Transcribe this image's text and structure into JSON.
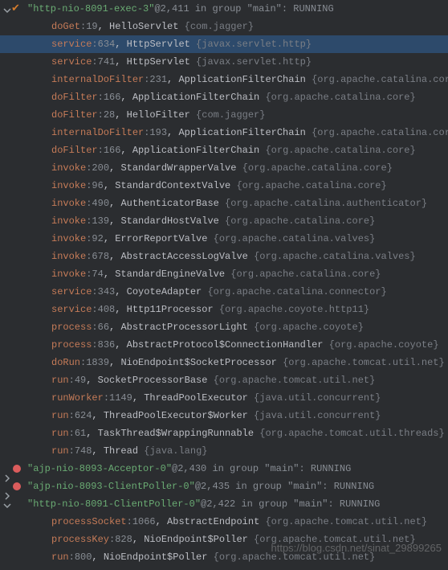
{
  "watermark": "https://blog.csdn.net/sinat_29899265",
  "threads": [
    {
      "expanded": true,
      "checked": true,
      "breakpoint": false,
      "name": "\"http-nio-8091-exec-3\"",
      "at": "@2,411",
      "group": " in group \"main\": ",
      "state": "RUNNING",
      "frames": [
        {
          "method": "doGet",
          "line": "19",
          "cls": "HelloServlet",
          "pkg": "com.jagger",
          "hl": false
        },
        {
          "method": "service",
          "line": "634",
          "cls": "HttpServlet",
          "pkg": "javax.servlet.http",
          "hl": true
        },
        {
          "method": "service",
          "line": "741",
          "cls": "HttpServlet",
          "pkg": "javax.servlet.http",
          "hl": false
        },
        {
          "method": "internalDoFilter",
          "line": "231",
          "cls": "ApplicationFilterChain",
          "pkg": "org.apache.catalina.core",
          "hl": false
        },
        {
          "method": "doFilter",
          "line": "166",
          "cls": "ApplicationFilterChain",
          "pkg": "org.apache.catalina.core",
          "hl": false
        },
        {
          "method": "doFilter",
          "line": "28",
          "cls": "HelloFilter",
          "pkg": "com.jagger",
          "hl": false
        },
        {
          "method": "internalDoFilter",
          "line": "193",
          "cls": "ApplicationFilterChain",
          "pkg": "org.apache.catalina.core",
          "hl": false
        },
        {
          "method": "doFilter",
          "line": "166",
          "cls": "ApplicationFilterChain",
          "pkg": "org.apache.catalina.core",
          "hl": false
        },
        {
          "method": "invoke",
          "line": "200",
          "cls": "StandardWrapperValve",
          "pkg": "org.apache.catalina.core",
          "hl": false
        },
        {
          "method": "invoke",
          "line": "96",
          "cls": "StandardContextValve",
          "pkg": "org.apache.catalina.core",
          "hl": false
        },
        {
          "method": "invoke",
          "line": "490",
          "cls": "AuthenticatorBase",
          "pkg": "org.apache.catalina.authenticator",
          "hl": false
        },
        {
          "method": "invoke",
          "line": "139",
          "cls": "StandardHostValve",
          "pkg": "org.apache.catalina.core",
          "hl": false
        },
        {
          "method": "invoke",
          "line": "92",
          "cls": "ErrorReportValve",
          "pkg": "org.apache.catalina.valves",
          "hl": false
        },
        {
          "method": "invoke",
          "line": "678",
          "cls": "AbstractAccessLogValve",
          "pkg": "org.apache.catalina.valves",
          "hl": false
        },
        {
          "method": "invoke",
          "line": "74",
          "cls": "StandardEngineValve",
          "pkg": "org.apache.catalina.core",
          "hl": false
        },
        {
          "method": "service",
          "line": "343",
          "cls": "CoyoteAdapter",
          "pkg": "org.apache.catalina.connector",
          "hl": false
        },
        {
          "method": "service",
          "line": "408",
          "cls": "Http11Processor",
          "pkg": "org.apache.coyote.http11",
          "hl": false
        },
        {
          "method": "process",
          "line": "66",
          "cls": "AbstractProcessorLight",
          "pkg": "org.apache.coyote",
          "hl": false
        },
        {
          "method": "process",
          "line": "836",
          "cls": "AbstractProtocol$ConnectionHandler",
          "pkg": "org.apache.coyote",
          "hl": false
        },
        {
          "method": "doRun",
          "line": "1839",
          "cls": "NioEndpoint$SocketProcessor",
          "pkg": "org.apache.tomcat.util.net",
          "hl": false
        },
        {
          "method": "run",
          "line": "49",
          "cls": "SocketProcessorBase",
          "pkg": "org.apache.tomcat.util.net",
          "hl": false
        },
        {
          "method": "runWorker",
          "line": "1149",
          "cls": "ThreadPoolExecutor",
          "pkg": "java.util.concurrent",
          "hl": false
        },
        {
          "method": "run",
          "line": "624",
          "cls": "ThreadPoolExecutor$Worker",
          "pkg": "java.util.concurrent",
          "hl": false
        },
        {
          "method": "run",
          "line": "61",
          "cls": "TaskThread$WrappingRunnable",
          "pkg": "org.apache.tomcat.util.threads",
          "hl": false
        },
        {
          "method": "run",
          "line": "748",
          "cls": "Thread",
          "pkg": "java.lang",
          "hl": false
        }
      ]
    },
    {
      "expanded": false,
      "checked": false,
      "breakpoint": true,
      "name": "\"ajp-nio-8093-Acceptor-0\"",
      "at": "@2,430",
      "group": " in group \"main\": ",
      "state": "RUNNING",
      "frames": []
    },
    {
      "expanded": false,
      "checked": false,
      "breakpoint": true,
      "name": "\"ajp-nio-8093-ClientPoller-0\"",
      "at": "@2,435",
      "group": " in group \"main\": ",
      "state": "RUNNING",
      "frames": []
    },
    {
      "expanded": true,
      "checked": false,
      "breakpoint": false,
      "name": "\"http-nio-8091-ClientPoller-0\"",
      "at": "@2,422",
      "group": " in group \"main\": ",
      "state": "RUNNING",
      "frames": [
        {
          "method": "processSocket",
          "line": "1066",
          "cls": "AbstractEndpoint",
          "pkg": "org.apache.tomcat.util.net",
          "hl": false
        },
        {
          "method": "processKey",
          "line": "828",
          "cls": "NioEndpoint$Poller",
          "pkg": "org.apache.tomcat.util.net",
          "hl": false
        },
        {
          "method": "run",
          "line": "800",
          "cls": "NioEndpoint$Poller",
          "pkg": "org.apache.tomcat.util.net",
          "hl": false
        }
      ]
    }
  ]
}
